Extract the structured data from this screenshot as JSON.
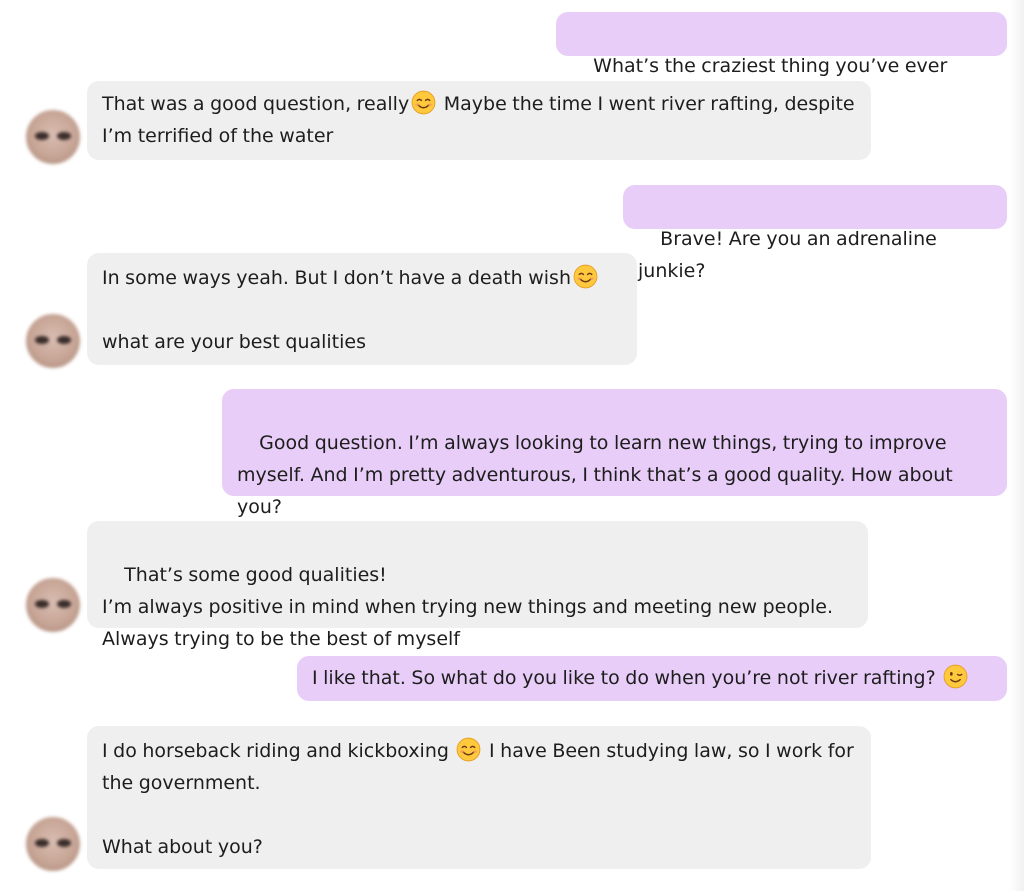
{
  "messages": [
    {
      "from": "me",
      "text": "What’s the craziest thing you’ve ever done?"
    },
    {
      "from": "them",
      "text_before": "That was a good question, really",
      "emoji": "smiling-face-icon",
      "text_after": " Maybe the time I went river rafting, despite I’m terrified of the water"
    },
    {
      "from": "me",
      "text": "Brave! Are you an adrenaline junkie?"
    },
    {
      "from": "them",
      "text_before": "In some ways yeah. But I don’t have a death wish",
      "emoji": "smiling-face-icon",
      "text_after": "\n\nwhat are your best qualities"
    },
    {
      "from": "me",
      "text": "Good question. I’m always looking to learn new things, trying to improve myself. And I’m pretty adventurous, I think that’s a good quality. How about you?"
    },
    {
      "from": "them",
      "text": "That’s some good qualities!\nI’m always positive in mind when trying new things and meeting new people.\nAlways trying to be the best of myself"
    },
    {
      "from": "me",
      "text_before": "I like that. So what do you like to do when you’re not river rafting? ",
      "emoji": "winking-face-icon",
      "text_after": ""
    },
    {
      "from": "them",
      "text_before": "I do horseback riding and kickboxing ",
      "emoji": "smiling-face-icon",
      "text_after": " I have Been studying law, so I work for the government.\n\nWhat about you?"
    }
  ],
  "colors": {
    "outgoing_bubble": "#e7cdf7",
    "incoming_bubble": "#efefef",
    "text": "#1d1d1d"
  }
}
